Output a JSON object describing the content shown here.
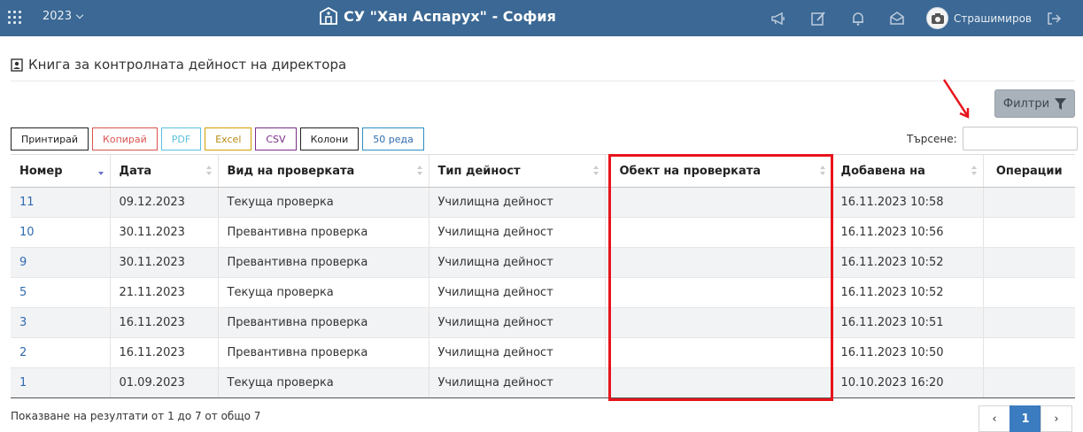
{
  "topbar": {
    "year": "2023",
    "school_name": "СУ \"Хан Аспарух\" - София",
    "user_name": "Страшимиров"
  },
  "page": {
    "title": "Книга за контролната дейност на директора"
  },
  "filter": {
    "label": "Филтри"
  },
  "buttons": [
    "Принтирай",
    "Копирай",
    "PDF",
    "Excel",
    "CSV",
    "Колони",
    "50 реда"
  ],
  "search": {
    "label": "Търсене:",
    "value": ""
  },
  "table": {
    "columns": [
      "Номер",
      "Дата",
      "Вид на проверката",
      "Тип дейност",
      "Обект на проверката",
      "Добавена на",
      "Операции"
    ],
    "rows": [
      [
        "11",
        "09.12.2023",
        "Текуща проверка",
        "Училищна дейност",
        "",
        "16.11.2023 10:58",
        ""
      ],
      [
        "10",
        "30.11.2023",
        "Превантивна проверка",
        "Училищна дейност",
        "",
        "16.11.2023 10:56",
        ""
      ],
      [
        "9",
        "30.11.2023",
        "Превантивна проверка",
        "Училищна дейност",
        "",
        "16.11.2023 10:52",
        ""
      ],
      [
        "5",
        "21.11.2023",
        "Текуща проверка",
        "Училищна дейност",
        "",
        "16.11.2023 10:52",
        ""
      ],
      [
        "3",
        "16.11.2023",
        "Превантивна проверка",
        "Училищна дейност",
        "",
        "16.11.2023 10:51",
        ""
      ],
      [
        "2",
        "16.11.2023",
        "Превантивна проверка",
        "Училищна дейност",
        "",
        "16.11.2023 10:50",
        ""
      ],
      [
        "1",
        "01.09.2023",
        "Текуща проверка",
        "Училищна дейност",
        "",
        "10.10.2023 16:20",
        ""
      ]
    ]
  },
  "info": "Показване на резултати от 1 до 7 от общо 7",
  "pagination": {
    "prev": "‹",
    "current": "1",
    "next": "›"
  },
  "colors": {
    "topbar": "#3b6894",
    "link": "#2f6bb0",
    "highlight": "#e8141c",
    "filter_button": "#a9b1ba",
    "page_active": "#3b7bbf"
  },
  "icons": [
    "apps-grid-icon",
    "school-building-icon",
    "megaphone-icon",
    "edit-icon",
    "bell-icon",
    "envelope-icon",
    "avatar-icon",
    "logout-icon",
    "user-card-icon",
    "filter-icon"
  ]
}
